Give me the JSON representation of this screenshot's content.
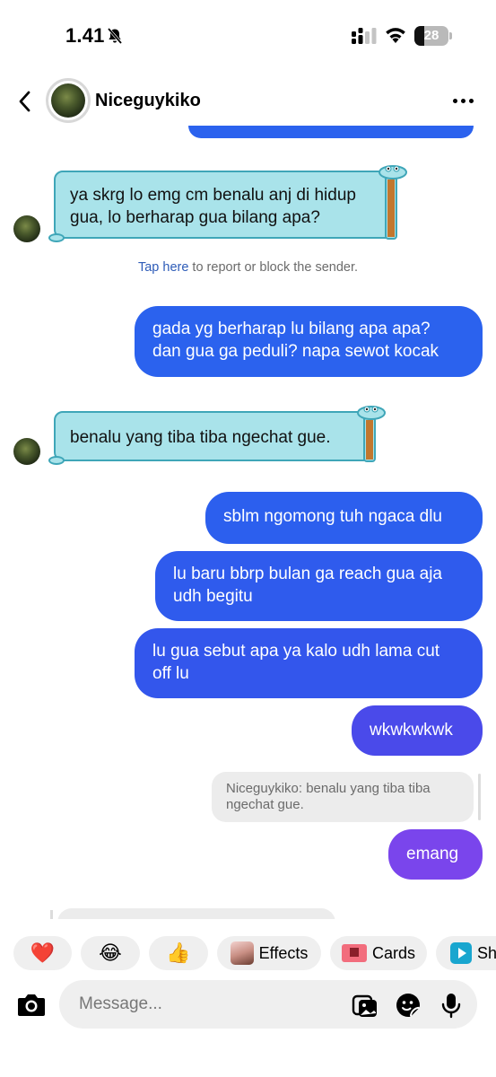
{
  "status_bar": {
    "time": "1.41",
    "battery": "28",
    "icons": [
      "bell-muted-icon",
      "signal-icon",
      "wifi-icon",
      "battery-icon"
    ]
  },
  "header": {
    "contact_name": "Niceguykiko",
    "icons": [
      "back-chevron-icon",
      "more-dots-icon"
    ]
  },
  "messages": {
    "recv1": {
      "line1": "ya skrg lo emg cm benalu anj di hidup",
      "line2": "gua, lo berharap gua bilang apa?"
    },
    "report": {
      "link": "Tap here",
      "rest": " to report or block the sender."
    },
    "sent1": {
      "line1": "gada yg berharap lu bilang apa apa?",
      "line2": "dan gua ga peduli? napa sewot kocak"
    },
    "recv2": {
      "line1": "benalu yang tiba tiba ngechat gue."
    },
    "sent2": {
      "line1": "sblm ngomong tuh ngaca dlu"
    },
    "sent3": {
      "line1": "lu baru bbrp bulan ga reach gua aja",
      "line2": "udh begitu"
    },
    "sent4": {
      "line1": "lu gua sebut apa ya kalo udh lama cut",
      "line2": "off lu"
    },
    "sent5": {
      "line1": "wkwkwkwk"
    },
    "reply_quote": {
      "line1": "Niceguykiko: benalu yang tiba tiba",
      "line2": "ngechat gue."
    },
    "sent6": {
      "line1": "emang"
    }
  },
  "colors": {
    "sent_blue": "#2b62ee",
    "sent_indigo": "#4b4bea",
    "sent_purple": "#7a45ec",
    "received_sticker": "#a9e3ea"
  },
  "quick_reactions": {
    "heart": "❤️",
    "laugh": "😂",
    "thumbs": "👍",
    "effects": "Effects",
    "cards": "Cards",
    "share": "Sh"
  },
  "composer": {
    "placeholder": "Message...",
    "icons": [
      "camera-icon",
      "gallery-icon",
      "sticker-icon",
      "microphone-icon"
    ]
  }
}
